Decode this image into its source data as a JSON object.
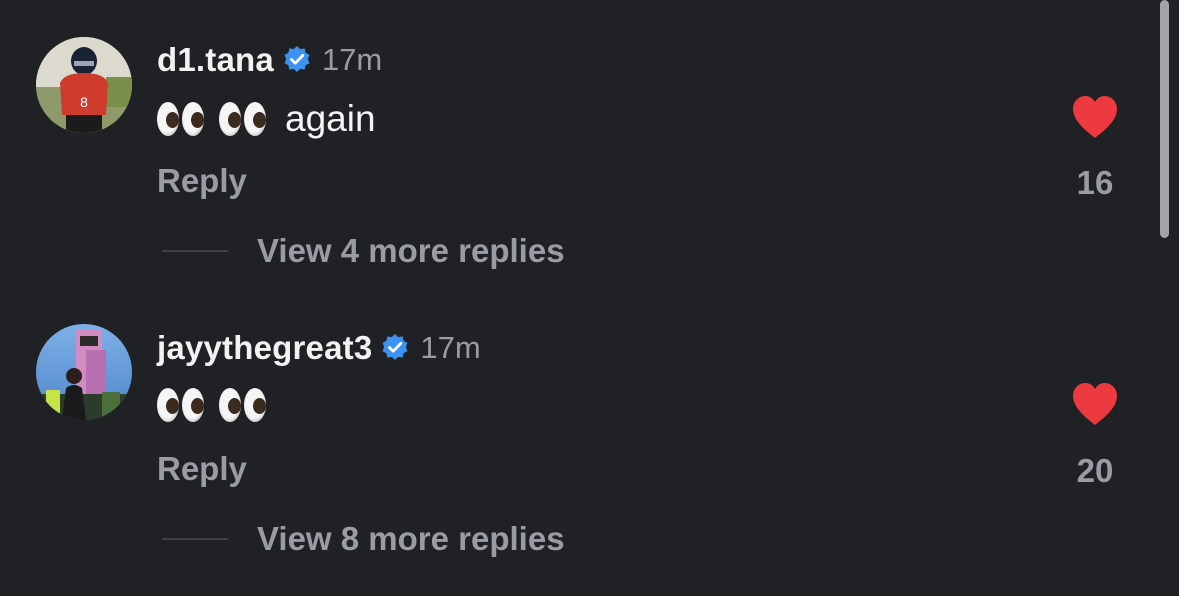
{
  "comments": [
    {
      "username": "d1.tana",
      "timestamp": "17m",
      "text": "again",
      "emoji": "eyes-emoji",
      "reply_label": "Reply",
      "like_count": "16",
      "view_replies": "View 4 more replies"
    },
    {
      "username": "jayythegreat3",
      "timestamp": "17m",
      "text": "",
      "emoji": "eyes-emoji",
      "reply_label": "Reply",
      "like_count": "20",
      "view_replies": "View 8 more replies"
    }
  ],
  "colors": {
    "background": "#202125",
    "verified_blue": "#3b92f0",
    "like_red": "#ed3a40",
    "muted_text": "#9a9ca3"
  },
  "icons": {
    "verified": "verified-badge-icon",
    "like": "heart-icon"
  }
}
